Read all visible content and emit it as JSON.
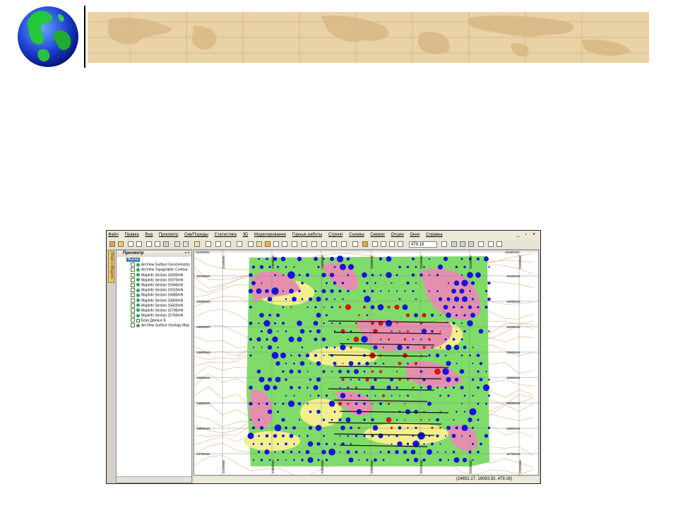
{
  "app": {
    "menu": [
      "Файл",
      "Правка",
      "Вид",
      "Просмотр",
      "Скв/Породы",
      "Статистика",
      "3D",
      "Моделирование",
      "Горные работы",
      "Стрингі",
      "Съемка",
      "Сервис",
      "Опции",
      "Окно",
      "Справка"
    ],
    "window_controls": "_ ▫ ×",
    "zoom_value": "479.18",
    "side_tab_label": "Инфо о Модели",
    "panel": {
      "title": "Просмотр",
      "pin": "▪ ×",
      "root": "Вьюер",
      "layers": [
        "ArcView Surface Geochemistry",
        "ArcView Topographic Contour",
        "MapInfo Section 16000mN",
        "MapInfo Section 15970mN",
        "MapInfo Section 15940mN",
        "MapInfo Section 15910mN",
        "MapInfo Section 15880mN",
        "MapInfo Section 15850mN",
        "MapInfo Section 15820mN",
        "MapInfo Section 15790mN",
        "MapInfo Section 15760mN",
        "База Данных Б",
        "ArcView Surface Geology Map"
      ]
    },
    "map": {
      "northing_labels": [
        "16100mN",
        "16050mN",
        "16000mN",
        "15950mN",
        "15900mN",
        "15850mN",
        "15800mN",
        "15750mN"
      ],
      "top_label": "16150mN",
      "easting_labels": [
        "24700mE",
        "24800mE",
        "24900mE",
        "25000mE",
        "25100mE",
        "25200mE",
        "25300mE"
      ],
      "colors": {
        "outcrop_pink": "#e58fae",
        "outcrop_green": "#7fdc68",
        "sediment_yellow": "#f2ef8c",
        "sample_blue": "#1515d8",
        "sample_red": "#e01010",
        "contour": "#e8b080"
      }
    },
    "status_coords": "(24652.17, 16083.92, 479.18)"
  }
}
